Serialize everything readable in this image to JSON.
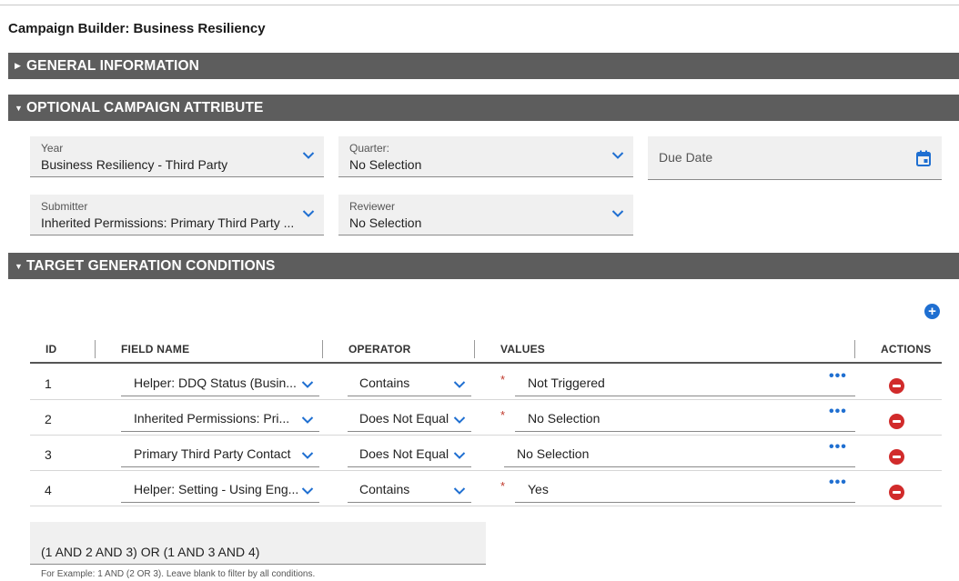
{
  "page_title": "Campaign Builder: Business Resiliency",
  "sections": {
    "general": {
      "label": "GENERAL INFORMATION",
      "expanded": false
    },
    "optional": {
      "label": "OPTIONAL CAMPAIGN ATTRIBUTE",
      "expanded": true
    },
    "target": {
      "label": "TARGET GENERATION CONDITIONS",
      "expanded": true
    }
  },
  "optional_fields": {
    "year": {
      "label": "Year",
      "value": "Business Resiliency - Third Party"
    },
    "quarter": {
      "label": "Quarter:",
      "value": "No Selection"
    },
    "due_date": {
      "label": "Due Date"
    },
    "submitter": {
      "label": "Submitter",
      "value": "Inherited Permissions: Primary Third Party ..."
    },
    "reviewer": {
      "label": "Reviewer",
      "value": "No Selection"
    }
  },
  "conditions_table": {
    "headers": {
      "id": "ID",
      "field_name": "FIELD NAME",
      "operator": "OPERATOR",
      "values": "VALUES",
      "actions": "ACTIONS"
    },
    "rows": [
      {
        "id": "1",
        "field": "Helper: DDQ Status (Busin...",
        "operator": "Contains",
        "required": "*",
        "value": "Not Triggered",
        "more": "•••"
      },
      {
        "id": "2",
        "field": "Inherited Permissions: Pri...",
        "operator": "Does Not Equal",
        "required": "*",
        "value": "No Selection",
        "more": "•••"
      },
      {
        "id": "3",
        "field": "Primary Third Party Contact",
        "operator": "Does Not Equal",
        "required": "",
        "value": "No Selection",
        "more": "•••"
      },
      {
        "id": "4",
        "field": "Helper: Setting - Using Eng...",
        "operator": "Contains",
        "required": "*",
        "value": "Yes",
        "more": "•••"
      }
    ]
  },
  "logic": {
    "value": "(1 AND 2 AND 3) OR (1 AND 3 AND 4)",
    "hint": "For Example: 1 AND (2 OR 3). Leave blank to filter by all conditions."
  },
  "icons": {
    "add": "plus-circle-icon",
    "remove": "minus-circle-icon",
    "calendar": "calendar-icon",
    "more": "ellipsis-icon",
    "dropdown": "chevron-down-icon"
  },
  "colors": {
    "section_bar": "#5d5d5d",
    "accent_blue": "#1f6fd1",
    "remove_red": "#d12b2b",
    "field_bg": "#f0f0f0"
  }
}
